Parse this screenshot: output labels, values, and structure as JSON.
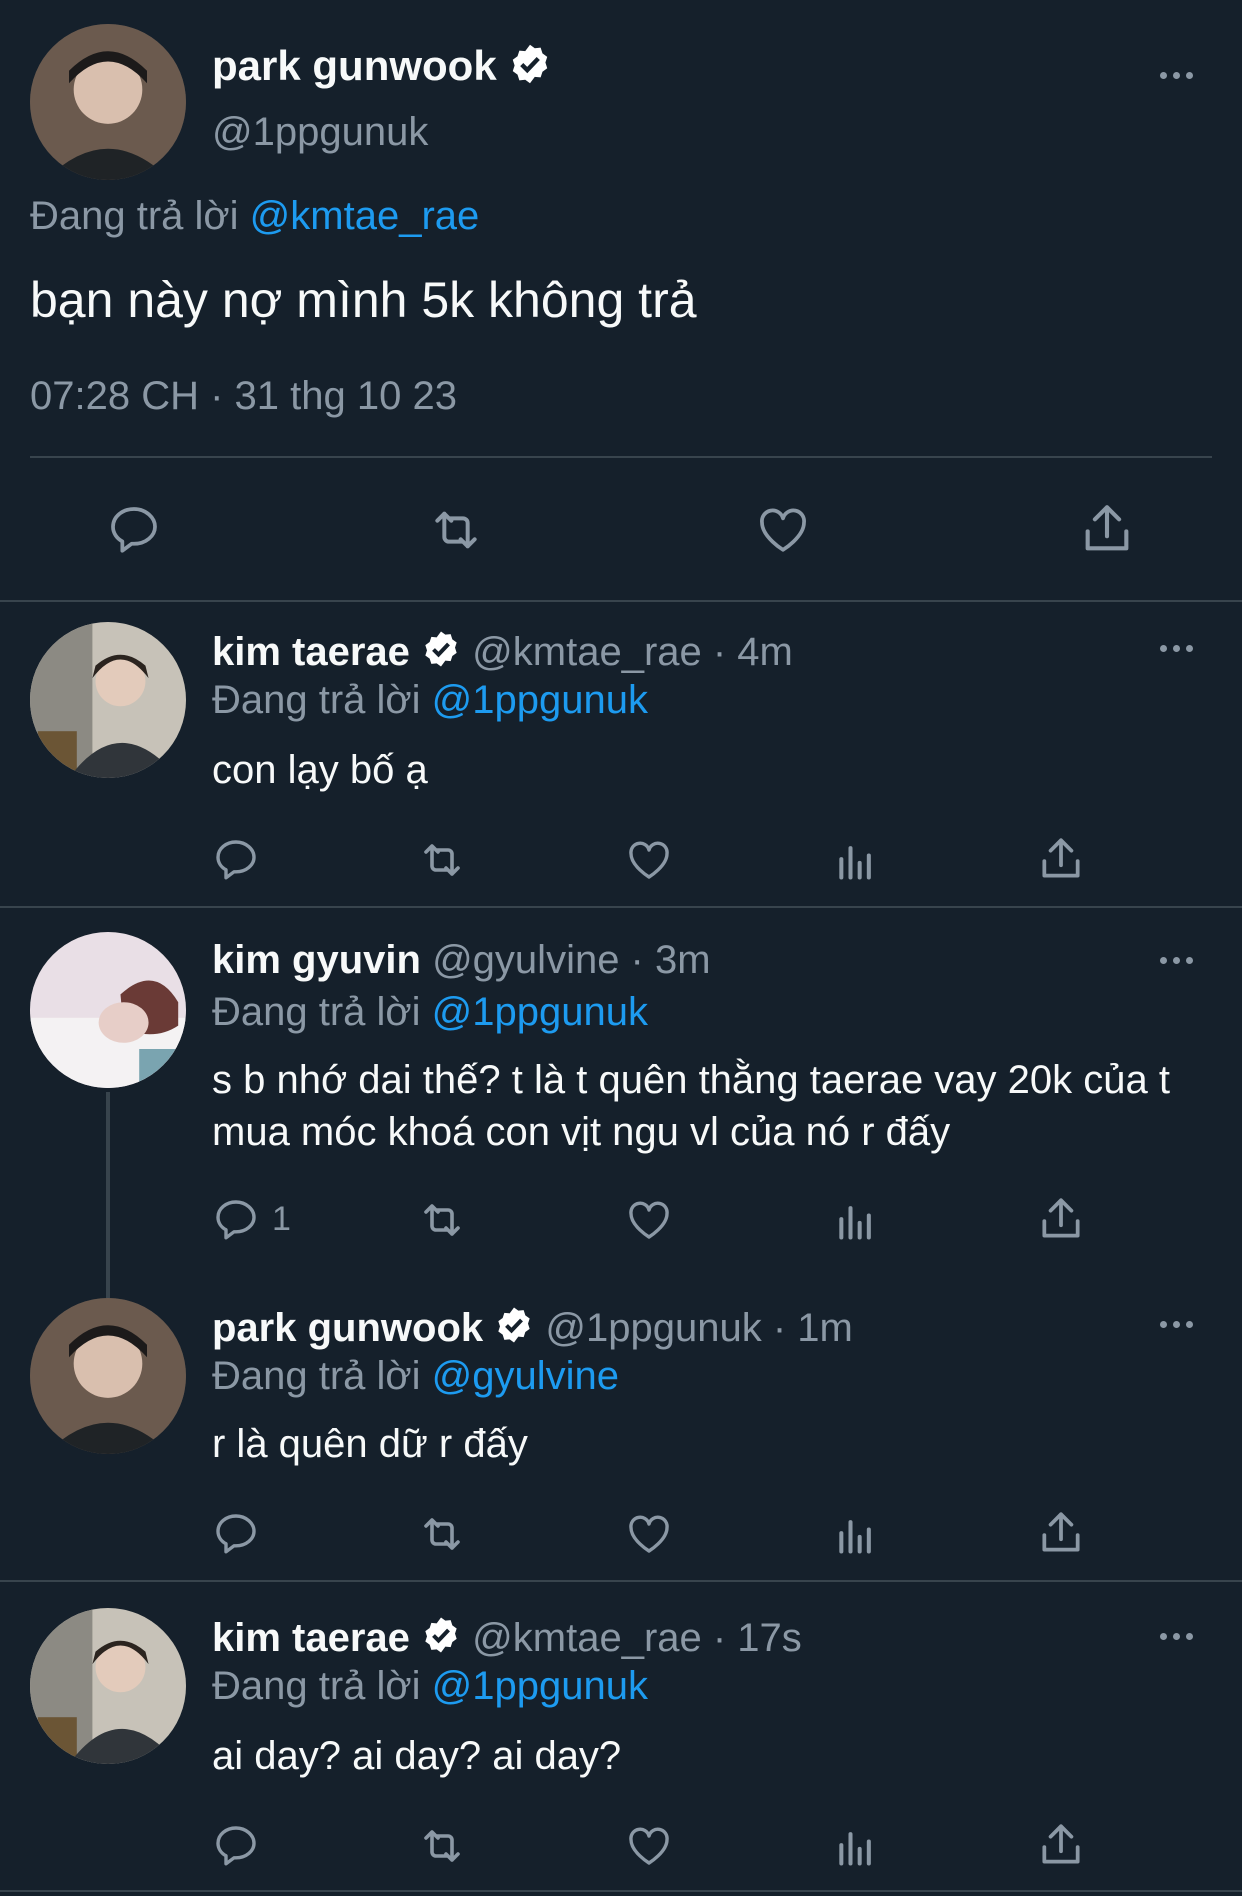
{
  "main_tweet": {
    "name": "park gunwook",
    "handle": "@1ppgunuk",
    "reply_prefix": "Đang trả lời",
    "reply_to": "@kmtae_rae",
    "text": "bạn này nợ mình 5k không trả",
    "timestamp": "07:28 CH · 31 thg 10 23"
  },
  "replies": [
    {
      "name": "kim taerae",
      "verified": true,
      "meta": "@kmtae_rae · 4m",
      "reply_prefix": "Đang trả lời",
      "reply_to": "@1ppgunuk",
      "text": "con lạy bố ạ",
      "reply_count": ""
    },
    {
      "name": "kim gyuvin",
      "verified": false,
      "meta": "@gyulvine · 3m",
      "reply_prefix": "Đang trả lời",
      "reply_to": "@1ppgunuk",
      "text": "s b nhớ dai thế? t là t quên thằng taerae vay 20k của t mua móc khoá con vịt ngu vl của nó r đấy",
      "reply_count": "1"
    },
    {
      "name": "park gunwook",
      "verified": true,
      "meta": "@1ppgunuk · 1m",
      "reply_prefix": "Đang trả lời",
      "reply_to": "@gyulvine",
      "text": "r là quên dữ r đấy",
      "reply_count": ""
    },
    {
      "name": "kim taerae",
      "verified": true,
      "meta": "@kmtae_rae · 17s",
      "reply_prefix": "Đang trả lời",
      "reply_to": "@1ppgunuk",
      "text": "ai day? ai day? ai day?",
      "reply_count": ""
    }
  ],
  "icons": {
    "reply": "reply-icon",
    "retweet": "retweet-icon",
    "like": "like-icon",
    "views": "views-icon",
    "share": "share-icon",
    "more": "more-icon",
    "verified": "verified-badge-icon"
  },
  "colors": {
    "background": "#15202b",
    "link": "#1d9bf0",
    "muted": "#8b98a5",
    "divider": "#38444d"
  }
}
